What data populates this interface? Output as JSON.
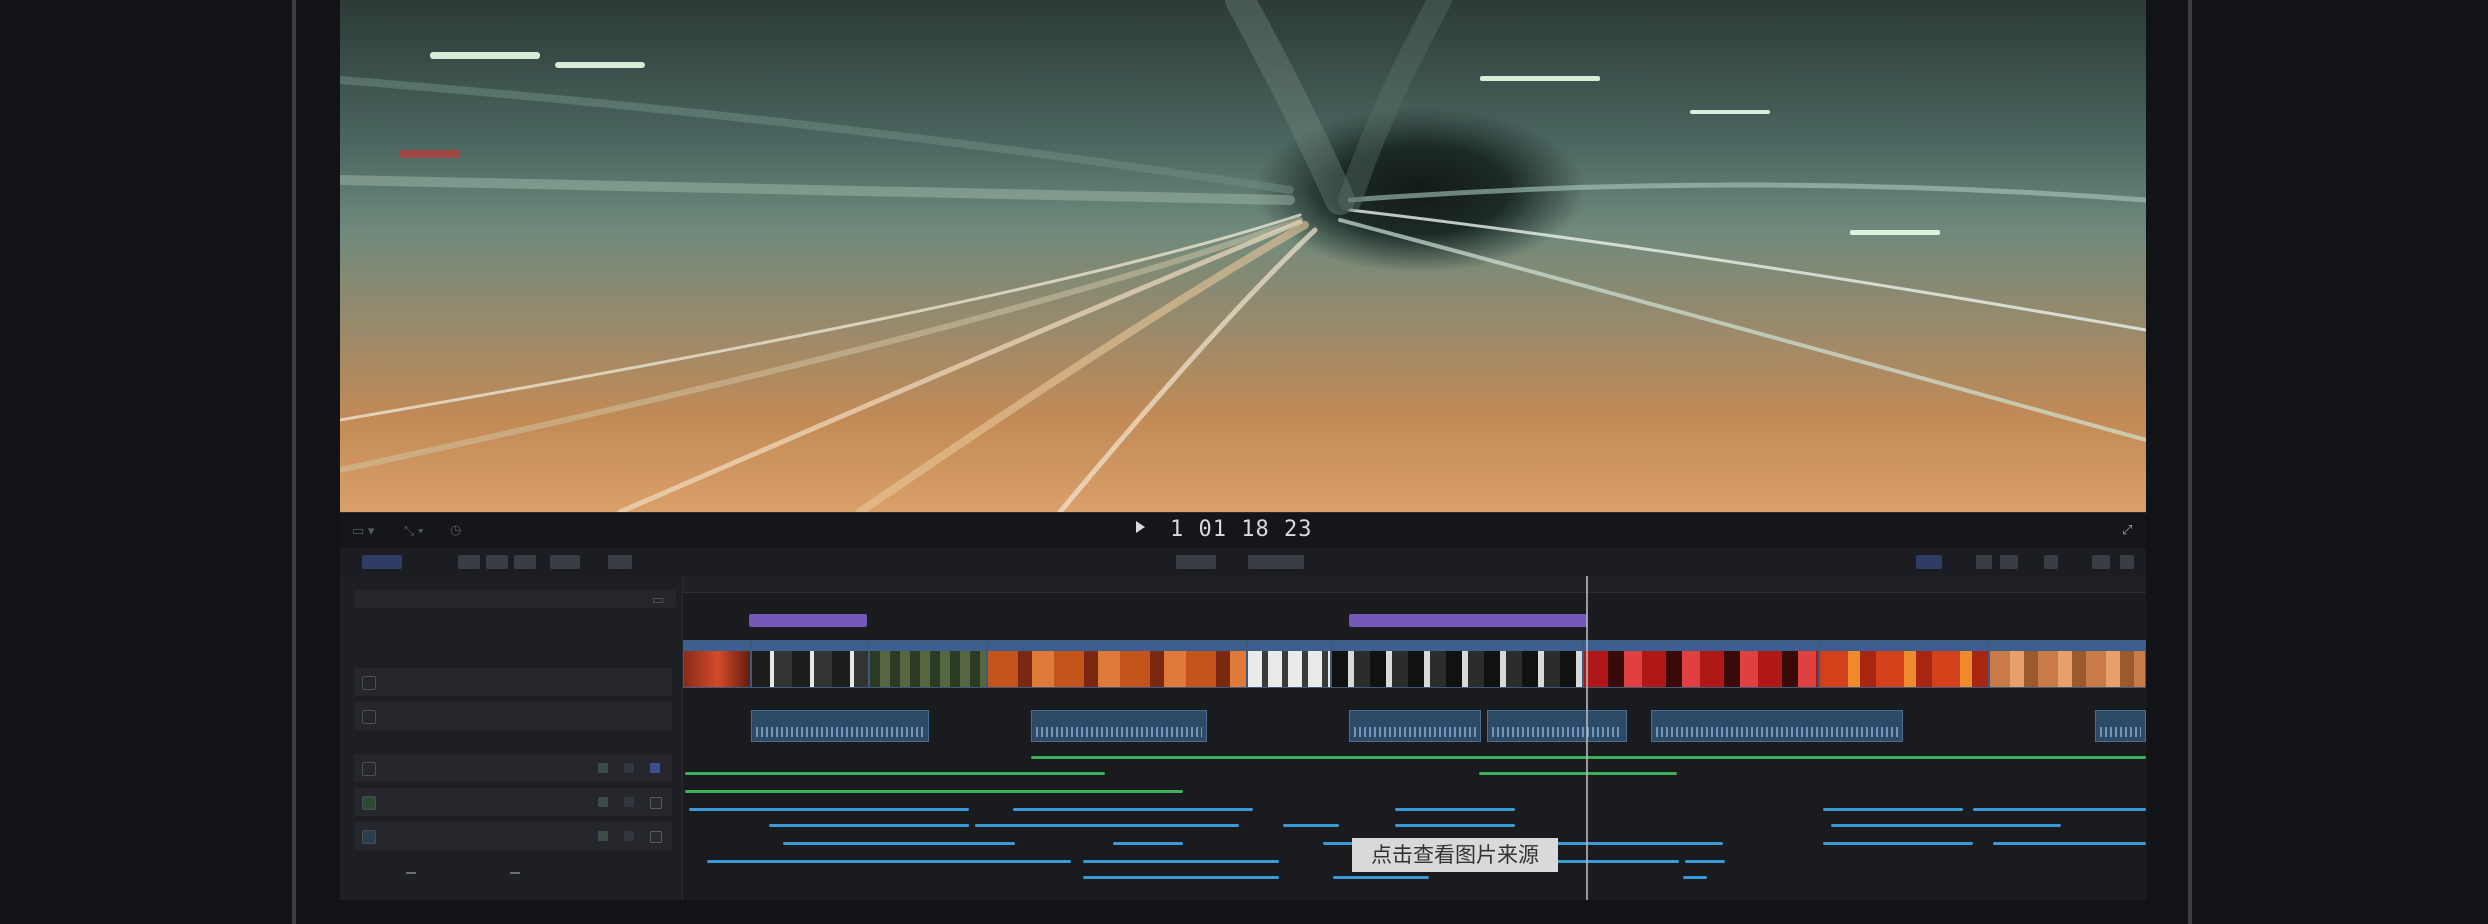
{
  "viewer": {
    "timecode": "1 01 18 23"
  },
  "transport": {
    "fullscreen_icon": "expand-icon"
  },
  "toolbar": {
    "index_label": "",
    "center_label": "",
    "right_label": ""
  },
  "panel": {
    "search_placeholder": "",
    "tabs": [
      "",
      "",
      ""
    ],
    "count": "",
    "rows": [
      "",
      "",
      "",
      "",
      ""
    ],
    "footer_buttons": [
      "",
      ""
    ]
  },
  "timeline": {
    "ruler": [
      "",
      "",
      "",
      "",
      "",
      "",
      "",
      "",
      ""
    ]
  },
  "watermark": {
    "text": "点击查看图片来源"
  },
  "colors": {
    "title_clip": "#7358b8",
    "video_clip": "#3b5f8f",
    "audio_green": "#3fb05a",
    "audio_blue": "#3b9ad8"
  }
}
